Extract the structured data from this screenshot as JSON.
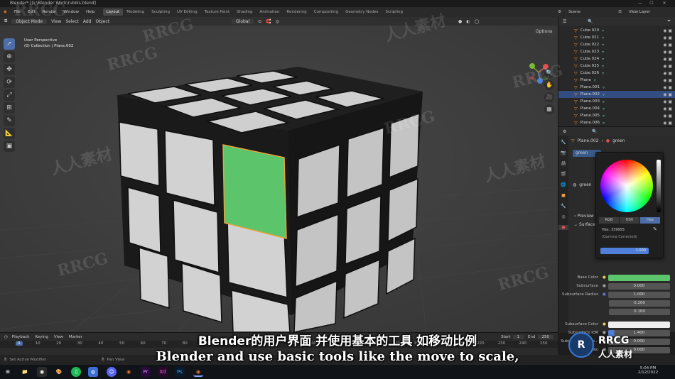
{
  "window": {
    "title": "Blender* [G:\\Blender Work\\rubiks.blend]",
    "controls": [
      "—",
      "☐",
      "✕"
    ]
  },
  "menu": [
    "File",
    "Edit",
    "Render",
    "Window",
    "Help"
  ],
  "workspace_tabs": [
    "Layout",
    "Modeling",
    "Sculpting",
    "UV Editing",
    "Texture Paint",
    "Shading",
    "Animation",
    "Rendering",
    "Compositing",
    "Geometry Nodes",
    "Scripting"
  ],
  "scene": {
    "scene_label": "Scene",
    "viewlayer_label": "View Layer"
  },
  "viewport_header": {
    "mode": "Object Mode",
    "menus": [
      "View",
      "Select",
      "Add",
      "Object"
    ],
    "orientation": "Global",
    "options": "Options"
  },
  "viewport_info": {
    "perspective": "User Perspective",
    "collection": "(0) Collection | Plane.002"
  },
  "outliner": {
    "items": [
      {
        "name": "Cube.020",
        "selected": false
      },
      {
        "name": "Cube.021",
        "selected": false
      },
      {
        "name": "Cube.022",
        "selected": false
      },
      {
        "name": "Cube.023",
        "selected": false
      },
      {
        "name": "Cube.024",
        "selected": false
      },
      {
        "name": "Cube.025",
        "selected": false
      },
      {
        "name": "Cube.026",
        "selected": false
      },
      {
        "name": "Plane",
        "selected": false
      },
      {
        "name": "Plane.001",
        "selected": false
      },
      {
        "name": "Plane.002",
        "selected": true
      },
      {
        "name": "Plane.003",
        "selected": false
      },
      {
        "name": "Plane.004",
        "selected": false
      },
      {
        "name": "Plane.005",
        "selected": false
      },
      {
        "name": "Plane.006",
        "selected": false
      }
    ]
  },
  "properties": {
    "breadcrumb_object": "Plane.002",
    "breadcrumb_material": "green",
    "material_slot": "green",
    "material_name": "green",
    "preview_label": "Preview",
    "surface_label": "Surface",
    "rows": [
      {
        "label": "Base Color",
        "value": ""
      },
      {
        "label": "Subsurface",
        "value": "0.000"
      },
      {
        "label": "Subsurface Radius",
        "value": "1.000"
      },
      {
        "label": "",
        "value": "0.200"
      },
      {
        "label": "",
        "value": "0.100"
      },
      {
        "label": "Subsurface Color",
        "value": ""
      },
      {
        "label": "Subsurface IOR",
        "value": "1.400"
      },
      {
        "label": "Subsurface Aniso...",
        "value": "0.000"
      },
      {
        "label": "Metallic",
        "value": "0.000"
      }
    ],
    "base_color": "#5cc46a"
  },
  "color_picker": {
    "tabs": [
      "RGB",
      "HSV",
      "Hex"
    ],
    "hex_label": "Hex: 339955",
    "gamma_note": "(Gamma Corrected)",
    "value": "1.000"
  },
  "timeline": {
    "menus": [
      "Playback",
      "Keying",
      "View",
      "Marker"
    ],
    "start_label": "Start",
    "start": "1",
    "end_label": "End",
    "end": "250",
    "current_frame": "0",
    "ticks": [
      "0",
      "10",
      "20",
      "30",
      "40",
      "50",
      "60",
      "70",
      "80",
      "90",
      "100",
      "110",
      "120",
      "130",
      "140",
      "150",
      "160",
      "170",
      "180",
      "190",
      "200",
      "210",
      "220",
      "230",
      "240",
      "250"
    ]
  },
  "status_bar": {
    "left": "Set Active Modifier",
    "middle": "Pan View"
  },
  "taskbar": {
    "time": "5:04 PM",
    "date": "2/12/2022"
  },
  "subtitles": {
    "chinese": "Blender的用户界面 并使用基本的工具 如移动比例",
    "english": "Blender and use basic tools like the move to scale,"
  },
  "watermarks": {
    "rrcg": "RRCG",
    "chinese": "人人素材",
    "logo_brand": "RRCG",
    "logo_chinese": "人人素材"
  },
  "colors": {
    "selection": "#334d80",
    "accent": "#4d6ea8",
    "object_icon": "#e79a48",
    "material_icon": "#6cc9c0"
  }
}
